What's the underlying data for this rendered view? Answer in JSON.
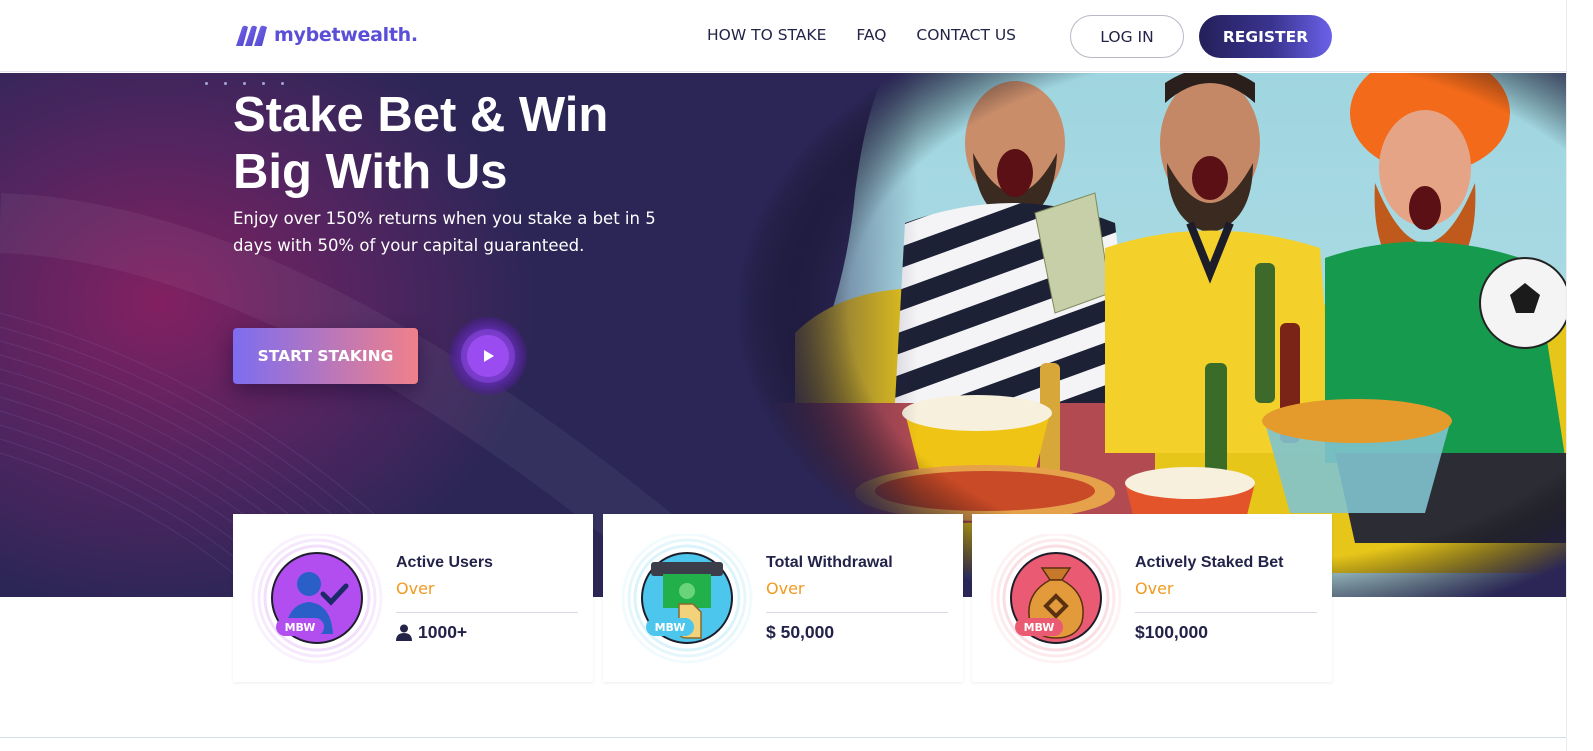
{
  "brand": {
    "name": "mybetwealth.",
    "color": "#5a4fd6"
  },
  "nav": {
    "items": [
      {
        "label": "HOW TO STAKE"
      },
      {
        "label": "FAQ"
      },
      {
        "label": "CONTACT US"
      }
    ],
    "login_label": "LOG IN",
    "register_label": "REGISTER"
  },
  "hero": {
    "title_line1": "Stake Bet & Win",
    "title_line2": "Big With Us",
    "subtitle": "Enjoy over 150% returns when you stake a bet in 5 days with 50% of your capital guaranteed.",
    "cta_label": "START STAKING",
    "play_icon": "play-icon"
  },
  "stats": [
    {
      "label": "Active Users",
      "over": "Over",
      "value": "1000+",
      "value_icon": "user-icon",
      "badge": "MBW",
      "icon": "user-check-icon",
      "color": "#b24ef0"
    },
    {
      "label": "Total Withdrawal",
      "over": "Over",
      "value": "$ 50,000",
      "value_icon": "",
      "badge": "MBW",
      "icon": "cash-withdraw-icon",
      "color": "#4cc6ec"
    },
    {
      "label": "Actively Staked Bet",
      "over": "Over",
      "value": "$100,000",
      "value_icon": "",
      "badge": "MBW",
      "icon": "money-bag-icon",
      "color": "#ea5a72"
    }
  ],
  "colors": {
    "hero_bg": "#2b2656",
    "accent_orange": "#f19a1e",
    "register_gradient_end": "#6a62e8"
  }
}
